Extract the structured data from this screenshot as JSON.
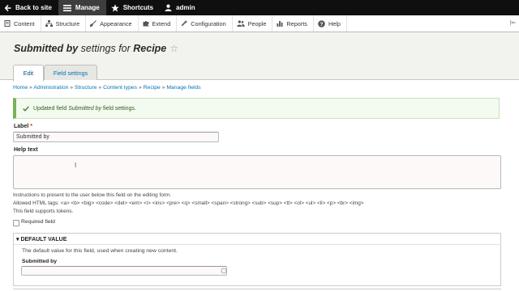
{
  "toolbar": {
    "back": "Back to site",
    "manage": "Manage",
    "shortcuts": "Shortcuts",
    "user": "admin"
  },
  "tray": {
    "items": [
      "Content",
      "Structure",
      "Appearance",
      "Extend",
      "Configuration",
      "People",
      "Reports",
      "Help"
    ],
    "collapse": "|⇐"
  },
  "page": {
    "title_prefix": "Submitted by",
    "title_mid": " settings for ",
    "title_suffix": "Recipe",
    "star": "☆"
  },
  "tabs": [
    "Edit",
    "Field settings"
  ],
  "breadcrumb": [
    "Home",
    "Administration",
    "Structure",
    "Content types",
    "Recipe",
    "Manage fields"
  ],
  "breadcrumb_sep": " » ",
  "message": {
    "pre": "Updated field ",
    "field": "Submitted by",
    "post": " field settings."
  },
  "form": {
    "label_title": "Label",
    "label_required": "*",
    "label_value": "Submitted by",
    "help_title": "Help text",
    "help_value": "",
    "help_desc1": "Instructions to present to the user below this field on the editing form.",
    "help_desc2": "Allowed HTML tags: <a> <b> <big> <code> <del> <em> <i> <ins> <pre> <q> <small> <span> <strong> <sub> <sup> <tt> <ol> <ul> <li> <p> <br> <img>",
    "help_desc3": "This field supports tokens.",
    "required_label": "Required field",
    "default_summary": "▾ DEFAULT VALUE",
    "default_desc": "The default value for this field, used when creating new content.",
    "default_field_label": "Submitted by",
    "default_field_value": ""
  }
}
